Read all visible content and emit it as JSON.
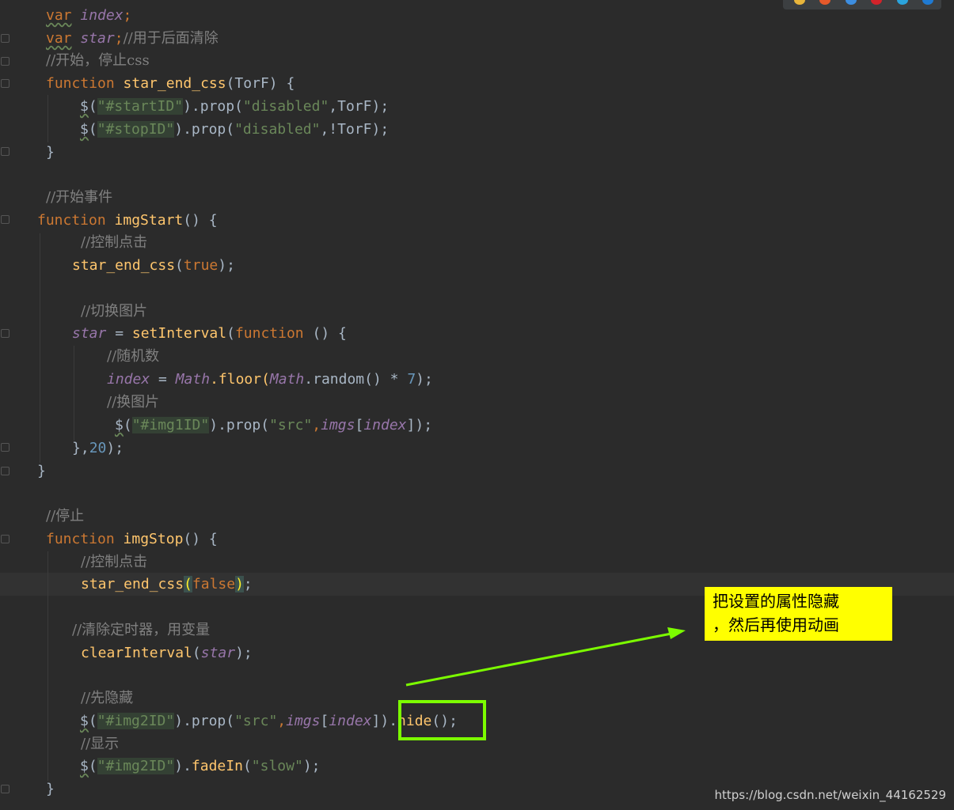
{
  "code_lines": {
    "l1": {
      "var": "var",
      "name": "index",
      "semi": ";"
    },
    "l2": {
      "var": "var",
      "name": "star",
      "semi": ";",
      "comment": "//用于后面清除"
    },
    "l3": {
      "comment": "//开始，停止css"
    },
    "l4": {
      "kw": "function",
      "fn": "star_end_css",
      "rest": "(TorF) {"
    },
    "l5": {
      "dollar": "$",
      "open": "(",
      "str": "\"#startID\"",
      "mid": ").prop(",
      "str2": "\"disabled\"",
      "rest": ",TorF);"
    },
    "l6": {
      "dollar": "$",
      "open": "(",
      "str": "\"#stopID\"",
      "mid": ").prop(",
      "str2": "\"disabled\"",
      "rest": ",!TorF);"
    },
    "l7": {
      "text": "}"
    },
    "l9": {
      "comment": "//开始事件"
    },
    "l10": {
      "kw": "function",
      "fn": "imgStart",
      "rest": "() {"
    },
    "l11": {
      "comment": "//控制点击"
    },
    "l12": {
      "fn": "star_end_css",
      "open": "(",
      "kw": "true",
      "rest": ");"
    },
    "l14": {
      "comment": "//切换图片"
    },
    "l15": {
      "gvar": "star",
      "eq": " = ",
      "fn": "setInterval",
      "open": "(",
      "kw": "function",
      "rest": " () {"
    },
    "l16": {
      "comment": "//随机数"
    },
    "l17": {
      "gvar": "index",
      "eq": " = ",
      "math": "Math",
      "dot1": ".floor(",
      "math2": "Math",
      "dot2": ".random() * ",
      "num": "7",
      "rest": ");"
    },
    "l18": {
      "comment": "//换图片"
    },
    "l19": {
      "dollar": "$",
      "open": "(",
      "str": "\"#img1ID\"",
      "mid": ").prop(",
      "str2": "\"src\"",
      "comma": ",",
      "gvar1": "imgs",
      "br": "[",
      "gvar2": "index",
      "rest": "]);"
    },
    "l20": {
      "close": "},",
      "num": "20",
      "rest": ");"
    },
    "l21": {
      "text": "}"
    },
    "l23": {
      "comment": "//停止"
    },
    "l24": {
      "kw": "function",
      "fn": "imgStop",
      "rest": "() {"
    },
    "l25": {
      "comment": "//控制点击"
    },
    "l26": {
      "fn": "star_end_css",
      "open": "(",
      "kw": "false",
      "close": ")",
      "rest": ";"
    },
    "l28": {
      "comment": "//清除定时器，用变量"
    },
    "l29": {
      "fn": "clearInterval",
      "open": "(",
      "gvar": "star",
      "rest": ");"
    },
    "l31": {
      "comment": "//先隐藏"
    },
    "l32": {
      "dollar": "$",
      "open": "(",
      "str": "\"#img2ID\"",
      "mid": ").prop(",
      "str2": "\"src\"",
      "comma": ",",
      "gvar1": "imgs",
      "br": "[",
      "gvar2": "index",
      "mid2": "]).",
      "fn": "hide",
      "rest": "();"
    },
    "l33": {
      "comment": "//显示"
    },
    "l34": {
      "dollar": "$",
      "open": "(",
      "str": "\"#img2ID\"",
      "mid": ").",
      "fn": "fadeIn",
      "open2": "(",
      "str2": "\"slow\"",
      "rest": ");"
    },
    "l35": {
      "text": "}"
    }
  },
  "annotation": {
    "line1": "把设置的属性隐藏",
    "line2": "，然后再使用动画"
  },
  "watermark": "https://blog.csdn.net/weixin_44162529",
  "browser_icons": [
    "chrome-icon",
    "firefox-icon",
    "safari-icon",
    "opera-icon",
    "ie-icon",
    "edge-icon"
  ],
  "colors": {
    "keyword": "#cc7832",
    "function": "#ffc66d",
    "string": "#6a8759",
    "comment": "#808080",
    "global_var": "#9876aa",
    "number": "#6897bb",
    "callout_bg": "#ffff00",
    "highlight_box": "#7cfc00"
  }
}
